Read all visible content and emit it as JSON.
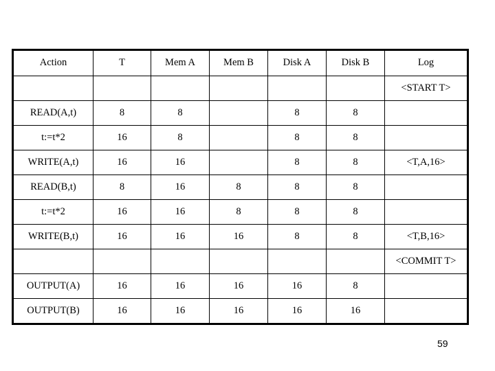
{
  "slide": {
    "page_number": "59",
    "background_color": "#ffffff",
    "text_color": "#000000",
    "border_color": "#000000"
  },
  "table": {
    "columns": [
      "Action",
      "T",
      "Mem A",
      "Mem B",
      "Disk A",
      "Disk B",
      "Log"
    ],
    "rows": [
      {
        "action": "",
        "t": "",
        "mem_a": "",
        "mem_b": "",
        "disk_a": "",
        "disk_b": "",
        "log": "<START T>"
      },
      {
        "action": "READ(A,t)",
        "t": "8",
        "mem_a": "8",
        "mem_b": "",
        "disk_a": "8",
        "disk_b": "8",
        "log": ""
      },
      {
        "action": "t:=t*2",
        "t": "16",
        "mem_a": "8",
        "mem_b": "",
        "disk_a": "8",
        "disk_b": "8",
        "log": ""
      },
      {
        "action": "WRITE(A,t)",
        "t": "16",
        "mem_a": "16",
        "mem_b": "",
        "disk_a": "8",
        "disk_b": "8",
        "log": "<T,A,16>"
      },
      {
        "action": "READ(B,t)",
        "t": "8",
        "mem_a": "16",
        "mem_b": "8",
        "disk_a": "8",
        "disk_b": "8",
        "log": ""
      },
      {
        "action": "t:=t*2",
        "t": "16",
        "mem_a": "16",
        "mem_b": "8",
        "disk_a": "8",
        "disk_b": "8",
        "log": ""
      },
      {
        "action": "WRITE(B,t)",
        "t": "16",
        "mem_a": "16",
        "mem_b": "16",
        "disk_a": "8",
        "disk_b": "8",
        "log": "<T,B,16>"
      },
      {
        "action": "",
        "t": "",
        "mem_a": "",
        "mem_b": "",
        "disk_a": "",
        "disk_b": "",
        "log": "<COMMIT T>"
      },
      {
        "action": "OUTPUT(A)",
        "t": "16",
        "mem_a": "16",
        "mem_b": "16",
        "disk_a": "16",
        "disk_b": "8",
        "log": ""
      },
      {
        "action": "OUTPUT(B)",
        "t": "16",
        "mem_a": "16",
        "mem_b": "16",
        "disk_a": "16",
        "disk_b": "16",
        "log": ""
      }
    ]
  }
}
